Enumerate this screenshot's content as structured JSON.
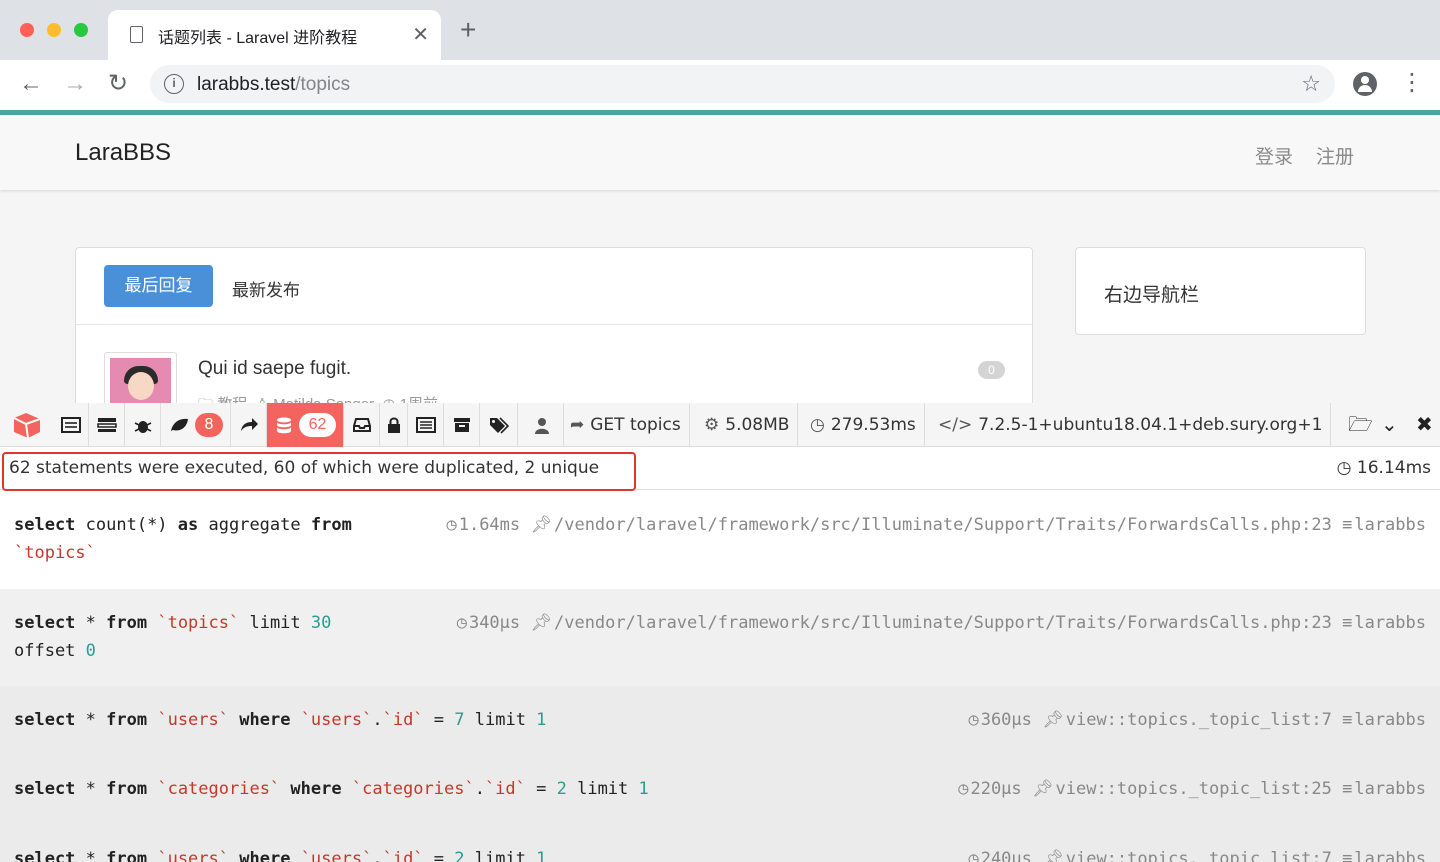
{
  "browser": {
    "tab_title": "话题列表 - Laravel 进阶教程",
    "url_host": "larabbs.test",
    "url_path": "/topics"
  },
  "page": {
    "brand": "LaraBBS",
    "nav": {
      "login": "登录",
      "register": "注册"
    },
    "tabs": {
      "last_reply": "最后回复",
      "newest": "最新发布"
    },
    "topic": {
      "title": "Qui id saepe fugit.",
      "reply_count": "0",
      "category": "教程",
      "author": "Matilda Sanger",
      "time": "1周前"
    },
    "sidebar_title": "右边导航栏"
  },
  "debugbar": {
    "messages_count": "8",
    "queries_count": "62",
    "route": "GET topics",
    "memory": "5.08MB",
    "duration": "279.53ms",
    "php_version": "7.2.5-1+ubuntu18.04.1+deb.sury.org+1",
    "summary": "62 statements were executed, 60 of which were duplicated, 2 unique",
    "total_time": "16.14ms",
    "statements": [
      {
        "duration": "1.64ms",
        "source": "/vendor/laravel/framework/src/Illuminate/Support/Traits/ForwardsCalls.php:23",
        "connection": "larabbs"
      },
      {
        "duration": "340μs",
        "source": "/vendor/laravel/framework/src/Illuminate/Support/Traits/ForwardsCalls.php:23",
        "connection": "larabbs"
      },
      {
        "duration": "360μs",
        "source": "view::topics._topic_list:7",
        "connection": "larabbs"
      },
      {
        "duration": "220μs",
        "source": "view::topics._topic_list:25",
        "connection": "larabbs"
      },
      {
        "duration": "240μs",
        "source": "view::topics._topic_list:7",
        "connection": "larabbs"
      }
    ]
  },
  "colors": {
    "accent": "#4ea5a0",
    "primary": "#4a90d9",
    "debugbar_red": "#f4645f",
    "highlight": "#e0362a"
  }
}
